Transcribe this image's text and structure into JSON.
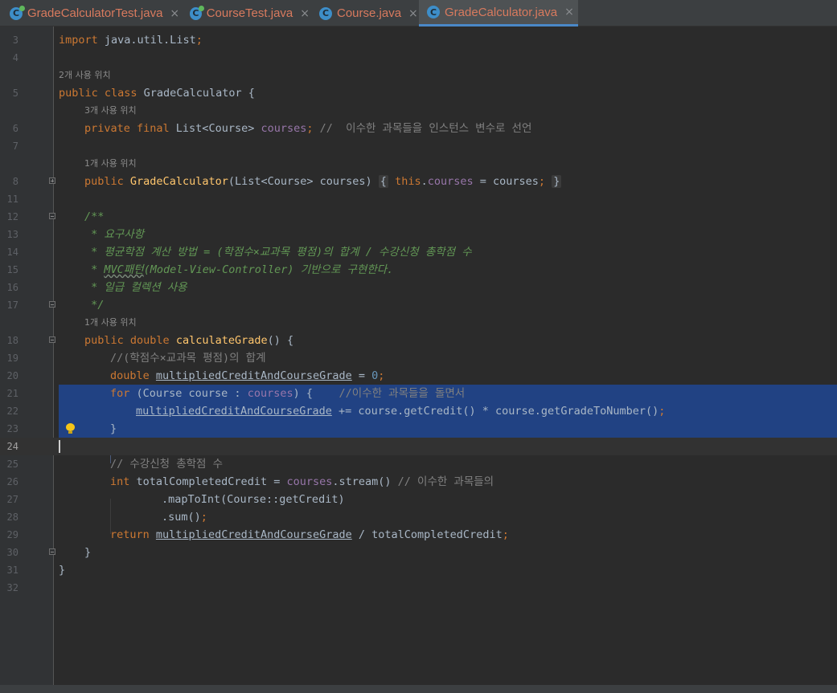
{
  "tabs": [
    {
      "label": "GradeCalculatorTest.java",
      "icon": "java-test-class-icon",
      "active": false
    },
    {
      "label": "CourseTest.java",
      "icon": "java-test-class-icon",
      "active": false
    },
    {
      "label": "Course.java",
      "icon": "java-class-icon",
      "active": false
    },
    {
      "label": "GradeCalculator.java",
      "icon": "java-class-icon",
      "active": true
    }
  ],
  "tab_icon_letter": "C",
  "close_glyph": "×",
  "colors": {
    "background": "#2b2b2b",
    "keyword": "#cc7832",
    "method": "#ffc66d",
    "field": "#9876aa",
    "comment": "#808080",
    "doc_comment": "#629755",
    "number": "#6897bb",
    "selection": "#214283"
  },
  "hints": {
    "usages_2": "2개 사용 위치",
    "usages_3": "3개 사용 위치",
    "usages_1a": "1개 사용 위치",
    "usages_1b": "1개 사용 위치"
  },
  "line_numbers": [
    "3",
    "4",
    "",
    "5",
    "",
    "6",
    "7",
    "",
    "8",
    "11",
    "12",
    "13",
    "14",
    "15",
    "16",
    "17",
    "",
    "18",
    "19",
    "20",
    "21",
    "22",
    "23",
    "24",
    "25",
    "26",
    "27",
    "28",
    "29",
    "30",
    "31",
    "32"
  ],
  "code": {
    "l3_import": "import",
    "l3_rest": " java.util.List",
    "l3_semi": ";",
    "l5_kw": "public class",
    "l5_name": " GradeCalculator {",
    "l6_kw": "private final",
    "l6_type": " List<Course> ",
    "l6_field": "courses",
    "l6_semi": ";",
    "l6_cmt": " //  이수한 과목들을 인스턴스 변수로 선언",
    "l8_kw": "public",
    "l8_name": "GradeCalculator",
    "l8_params": "(List<Course> courses)",
    "l8_brace_open": "{",
    "l8_this": "this",
    "l8_dot": ".",
    "l8_field": "courses",
    "l8_assign": " = courses",
    "l8_semi": ";",
    "l8_brace_close": "}",
    "l12": "/**",
    "l13": " * 요구사항",
    "l14": " * 평균학점 계산 방법 = (학점수×교과목 평점)의 합계 / 수강신청 총학점 수",
    "l15_star": " * ",
    "l15_mvc": "MVC패턴",
    "l15_rest": "(Model-View-Controller) 기반으로 구현한다.",
    "l16": " * 일급 컬렉션 사용",
    "l17": " */",
    "l18_kw": "public double",
    "l18_name": "calculateGrade",
    "l18_rest": "() {",
    "l19": "//(학점수×교과목 평점)의 합계",
    "l20_kw": "double",
    "l20_var": "multipliedCreditAndCourseGrade",
    "l20_eq": " = ",
    "l20_num": "0",
    "l20_semi": ";",
    "l21_kw": "for",
    "l21_mid": " (Course course : ",
    "l21_field": "courses",
    "l21_close": ") {",
    "l21_cmt": "//이수한 과목들을 돌면서",
    "l22_var": "multipliedCreditAndCourseGrade",
    "l22_rest": " += course.getCredit() * course.getGradeToNumber()",
    "l22_semi": ";",
    "l23": "}",
    "l25": "// 수강신청 총학점 수",
    "l26_kw": "int",
    "l26_mid": " totalCompletedCredit = ",
    "l26_field": "courses",
    "l26_rest": ".stream() ",
    "l26_cmt": "// 이수한 과목들의",
    "l27": ".mapToInt(Course::getCredit)",
    "l28": ".sum()",
    "l28_semi": ";",
    "l29_kw": "return",
    "l29_var": "multipliedCreditAndCourseGrade",
    "l29_rest": " / totalCompletedCredit",
    "l29_semi": ";",
    "l30": "}",
    "l31": "}"
  }
}
